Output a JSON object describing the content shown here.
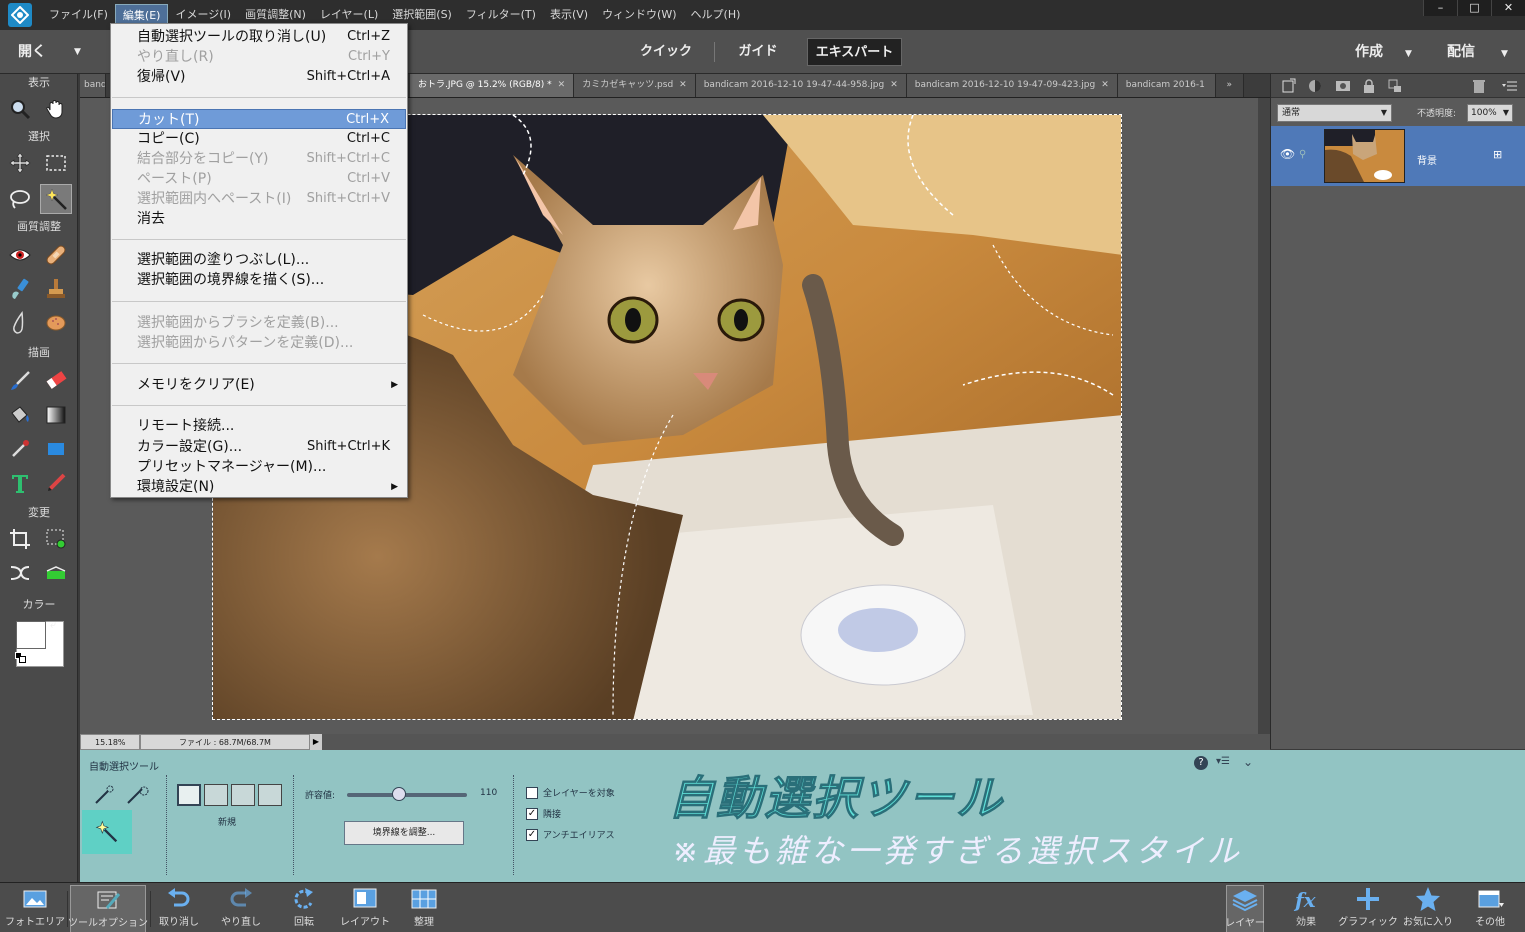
{
  "menubar": {
    "items": [
      "ファイル(F)",
      "編集(E)",
      "イメージ(I)",
      "画質調整(N)",
      "レイヤー(L)",
      "選択範囲(S)",
      "フィルター(T)",
      "表示(V)",
      "ウィンドウ(W)",
      "ヘルプ(H)"
    ],
    "window_controls": [
      "–",
      "□",
      "✕"
    ]
  },
  "modebar": {
    "open": "開く",
    "tabs": [
      "クイック",
      "ガイド",
      "エキスパート"
    ],
    "selected_tab": "エキスパート",
    "create": "作成",
    "share": "配信"
  },
  "toolbox": {
    "sections": [
      "表示",
      "選択",
      "画質調整",
      "描画",
      "変更",
      "カラー"
    ]
  },
  "doc_tabs": [
    {
      "label": "band",
      "active": false
    },
    {
      "label": "おトラ.JPG @ 15.2% (RGB/8) *",
      "active": true
    },
    {
      "label": "カミカゼキャッツ.psd",
      "active": false
    },
    {
      "label": "bandicam 2016-12-10 19-47-44-958.jpg",
      "active": false
    },
    {
      "label": "bandicam 2016-12-10 19-47-09-423.jpg",
      "active": false
    },
    {
      "label": "bandicam 2016-1",
      "active": false
    }
  ],
  "status": {
    "zoom": "15.18%",
    "file": "ファイル : 68.7M/68.7M"
  },
  "layers_panel": {
    "blend_mode": "通常",
    "opacity_label": "不透明度:",
    "opacity_value": "100%",
    "layer_name": "背景"
  },
  "edit_menu": {
    "groups": [
      [
        {
          "label": "自動選択ツールの取り消し(U)",
          "shortcut": "Ctrl+Z",
          "disabled": false
        },
        {
          "label": "やり直し(R)",
          "shortcut": "Ctrl+Y",
          "disabled": true
        },
        {
          "label": "復帰(V)",
          "shortcut": "Shift+Ctrl+A",
          "disabled": false
        }
      ],
      [
        {
          "label": "カット(T)",
          "shortcut": "Ctrl+X",
          "disabled": false,
          "highlight": true
        },
        {
          "label": "コピー(C)",
          "shortcut": "Ctrl+C",
          "disabled": false
        },
        {
          "label": "結合部分をコピー(Y)",
          "shortcut": "Shift+Ctrl+C",
          "disabled": true
        },
        {
          "label": "ペースト(P)",
          "shortcut": "Ctrl+V",
          "disabled": true
        },
        {
          "label": "選択範囲内へペースト(I)",
          "shortcut": "Shift+Ctrl+V",
          "disabled": true
        },
        {
          "label": "消去",
          "shortcut": "",
          "disabled": false
        }
      ],
      [
        {
          "label": "選択範囲の塗りつぶし(L)...",
          "shortcut": "",
          "disabled": false
        },
        {
          "label": "選択範囲の境界線を描く(S)...",
          "shortcut": "",
          "disabled": false
        }
      ],
      [
        {
          "label": "選択範囲からブラシを定義(B)...",
          "shortcut": "",
          "disabled": true
        },
        {
          "label": "選択範囲からパターンを定義(D)...",
          "shortcut": "",
          "disabled": true
        }
      ],
      [
        {
          "label": "メモリをクリア(E)",
          "shortcut": "",
          "disabled": false,
          "submenu": true
        }
      ],
      [
        {
          "label": "リモート接続...",
          "shortcut": "",
          "disabled": false
        },
        {
          "label": "カラー設定(G)...",
          "shortcut": "Shift+Ctrl+K",
          "disabled": false
        },
        {
          "label": "プリセットマネージャー(M)...",
          "shortcut": "",
          "disabled": false
        },
        {
          "label": "環境設定(N)",
          "shortcut": "",
          "disabled": false,
          "submenu": true
        }
      ]
    ]
  },
  "tool_options": {
    "title": "自動選択ツール",
    "new_label": "新規",
    "tolerance_label": "許容値:",
    "tolerance_value": "110",
    "tolerance": 110,
    "tolerance_max": 255,
    "refine_button": "境界線を調整...",
    "checkboxes": [
      {
        "label": "全レイヤーを対象",
        "checked": false
      },
      {
        "label": "隣接",
        "checked": true
      },
      {
        "label": "アンチエイリアス",
        "checked": true
      }
    ],
    "help": "?"
  },
  "caption": {
    "main": "自動選択ツール",
    "sub": "※最も雑な一発すぎる選択スタイル"
  },
  "taskbar": {
    "left": [
      "フォトエリア",
      "ツールオプション",
      "取り消し",
      "やり直し",
      "回転",
      "レイアウト",
      "整理"
    ],
    "right": [
      "レイヤー",
      "効果",
      "グラフィック",
      "お気に入り",
      "その他"
    ]
  }
}
